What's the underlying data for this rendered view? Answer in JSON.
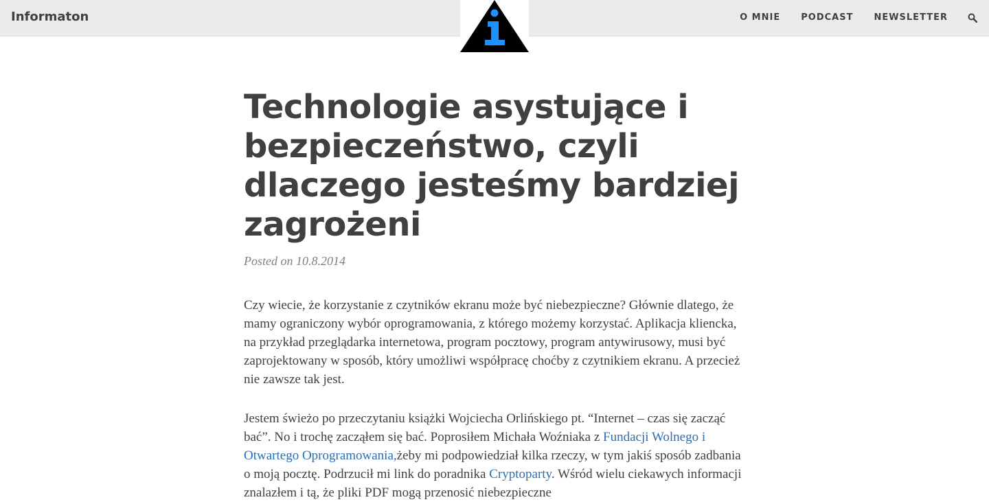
{
  "navbar": {
    "brand": "Informaton",
    "links": [
      "O MNIE",
      "PODCAST",
      "NEWSLETTER"
    ],
    "logo_letter": "i"
  },
  "post": {
    "title": "Technologie asystujące i bezpieczeństwo, czyli dlaczego jesteśmy bardziej zagrożeni",
    "meta_prefix": "Posted on",
    "date": "10.8.2014",
    "p1": "Czy wiecie, że korzystanie z czytników ekranu może być niebezpieczne? Głównie dlatego, że mamy ograniczony wybór oprogramowania, z którego możemy korzystać. Aplikacja kliencka, na przykład przeglądarka internetowa, program pocztowy, program antywirusowy, musi być zaprojektowany w sposób, który umożliwi współpracę choćby z czytnikiem ekranu. A przecież nie zawsze tak jest.",
    "p2_a": "Jestem świeżo po przeczytaniu książki Wojciecha Orlińskiego pt. “Internet – czas się zacząć bać”. No i trochę zacząłem się bać. Poprosiłem Michała Woźniaka z ",
    "p2_link1": "Fundacji Wolnego i Otwartego Oprogramowania,",
    "p2_b": "żeby mi podpowiedział kilka rzeczy, w tym jakiś sposób zadbania o moją pocztę. Podrzucił mi link do poradnika ",
    "p2_link2": "Cryptoparty",
    "p2_c": ". Wśród wielu ciekawych informacji znalazłem i tą, że pliki PDF mogą przenosić niebezpieczne"
  },
  "colors": {
    "navbar_bg": "#ebebeb",
    "text": "#404040",
    "link": "#2a6fb5",
    "logo_blue": "#1e90ff"
  }
}
